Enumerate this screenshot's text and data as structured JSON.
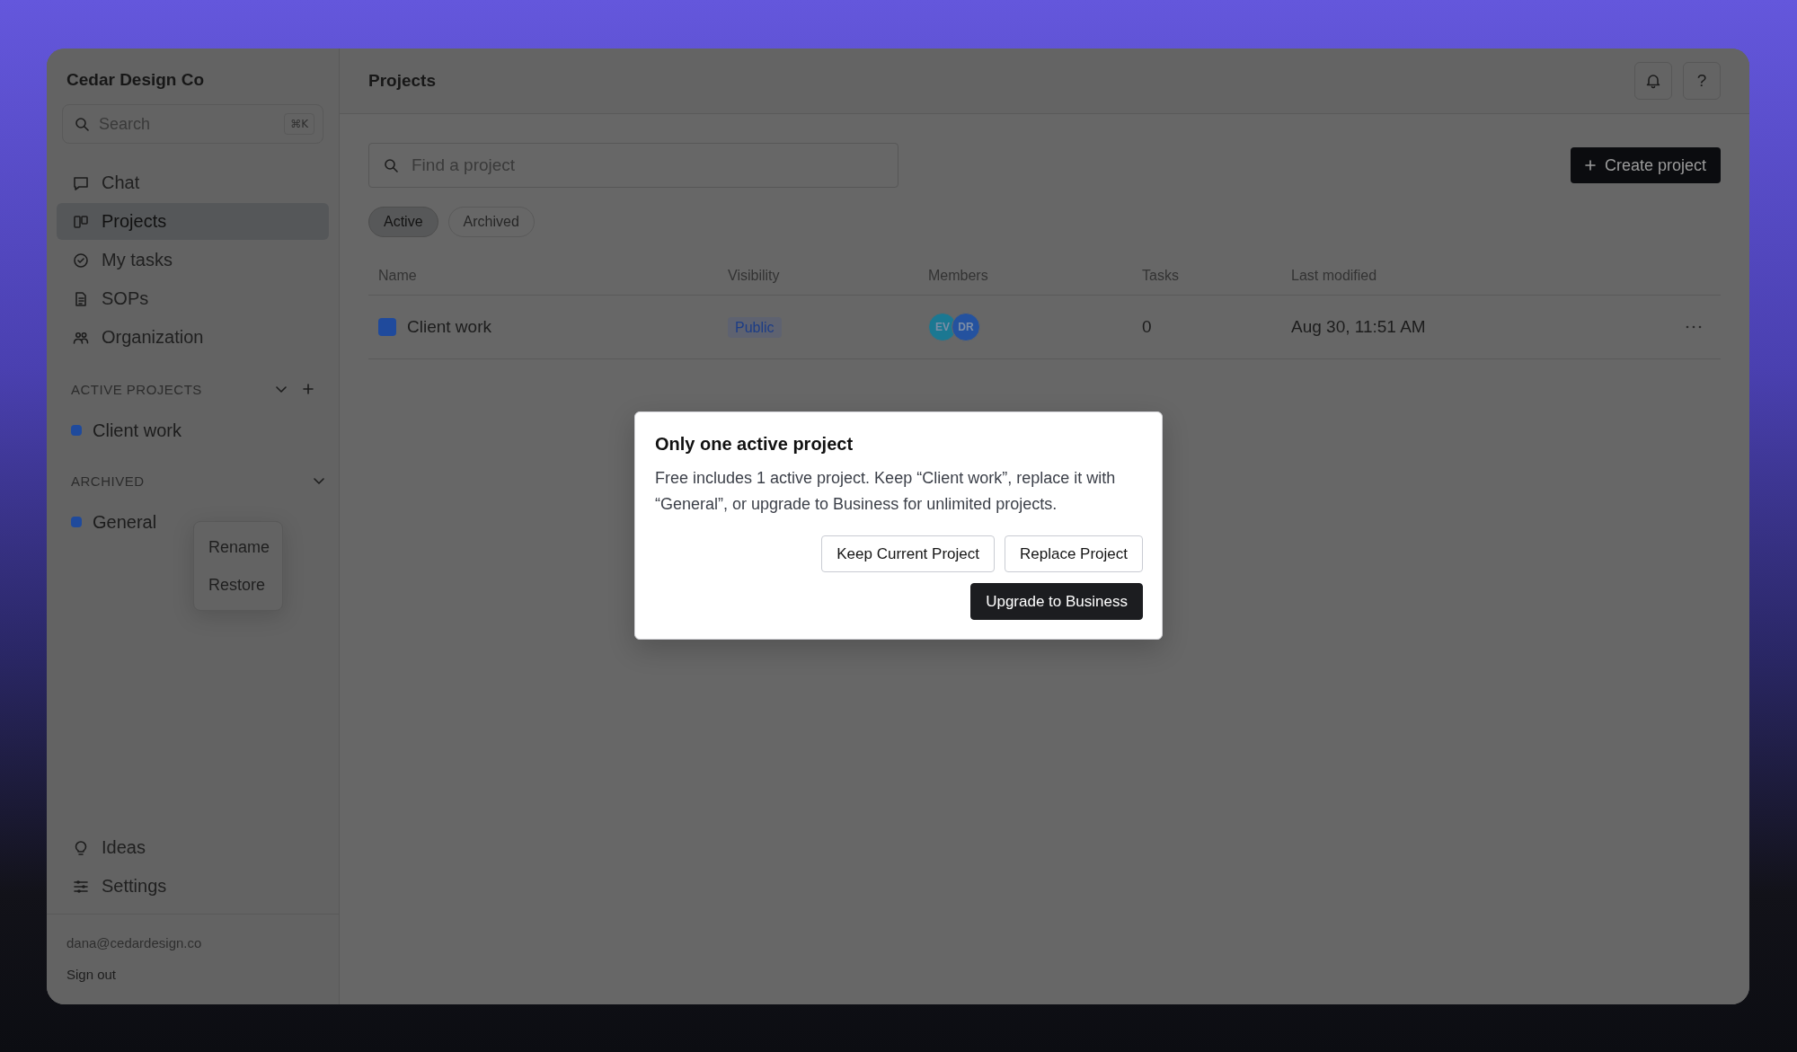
{
  "sidebar": {
    "workspace": "Cedar Design Co",
    "search": {
      "placeholder": "Search",
      "shortcut": "⌘K"
    },
    "nav": [
      {
        "label": "Chat",
        "selected": false
      },
      {
        "label": "Projects",
        "selected": true
      },
      {
        "label": "My tasks",
        "selected": false
      },
      {
        "label": "SOPs",
        "selected": false
      },
      {
        "label": "Organization",
        "selected": false
      }
    ],
    "sections": [
      {
        "title": "ACTIVE PROJECTS",
        "expanded": true,
        "can_add": true,
        "projects": [
          {
            "name": "Client work",
            "color": "#1f4a9c"
          }
        ]
      },
      {
        "title": "ARCHIVED",
        "expanded": true,
        "can_add": false,
        "projects": [
          {
            "name": "General",
            "color": "#1f4a9c"
          }
        ]
      }
    ],
    "context_menu": [
      "Rename",
      "Restore"
    ],
    "footer_nav": [
      {
        "label": "Ideas"
      },
      {
        "label": "Settings"
      }
    ],
    "account": {
      "email": "dana@cedardesign.co",
      "sign_out": "Sign out"
    }
  },
  "main": {
    "title": "Projects",
    "help": "?",
    "search": {
      "placeholder": "Find a project"
    },
    "create_button": "Create project",
    "filters": [
      {
        "label": "Active",
        "selected": true
      },
      {
        "label": "Archived",
        "selected": false
      }
    ],
    "table": {
      "columns": [
        "Name",
        "Visibility",
        "Members",
        "Tasks",
        "Last modified"
      ],
      "rows": [
        {
          "name": "Client work",
          "color": "#1f4a9c",
          "visibility": "Public",
          "members": [
            {
              "initials": "EV",
              "color": "#1b7892"
            },
            {
              "initials": "DR",
              "color": "#24529f"
            }
          ],
          "tasks": "0",
          "last_modified": "Aug 30, 11:51 AM"
        }
      ]
    }
  },
  "dialog": {
    "title": "Only one active project",
    "message": "Free includes 1 active project. Keep “Client work”, replace it with “General”, or upgrade to Business for unlimited projects.",
    "buttons": [
      {
        "label": "Keep Current Project",
        "kind": "secondary"
      },
      {
        "label": "Replace Project",
        "kind": "secondary"
      },
      {
        "label": "Upgrade to Business",
        "kind": "primary"
      }
    ]
  }
}
